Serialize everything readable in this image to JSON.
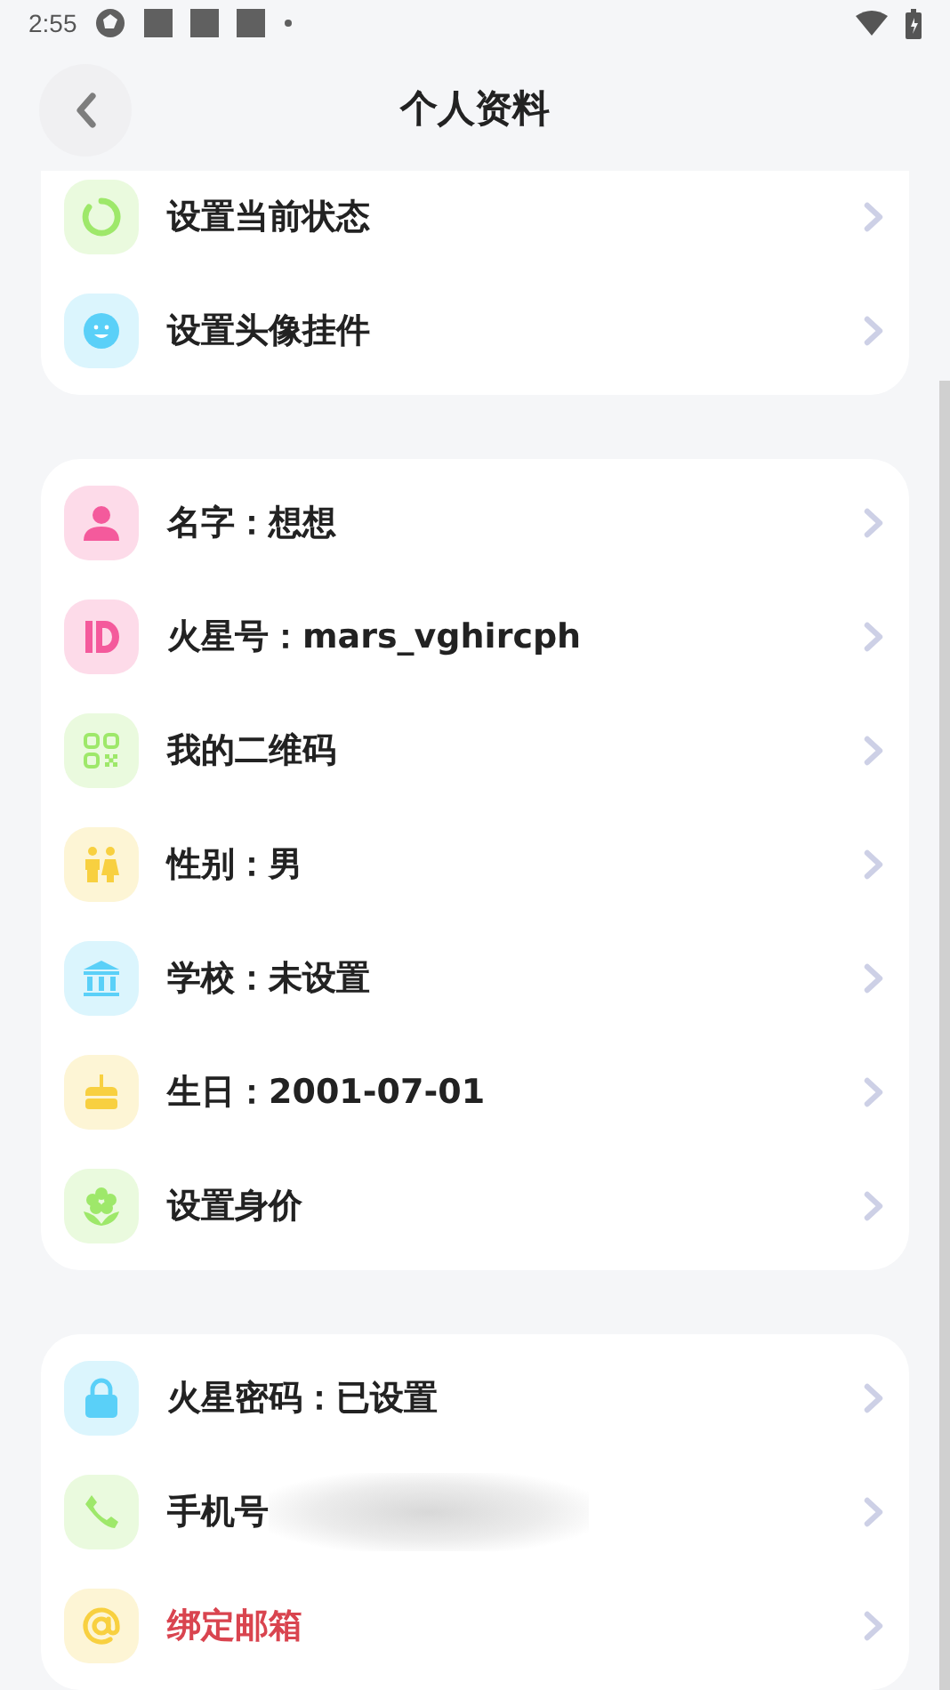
{
  "status_bar": {
    "time": "2:55"
  },
  "header": {
    "title": "个人资料"
  },
  "sections": [
    {
      "items": [
        {
          "label": "设置当前状态",
          "kind": "status",
          "color": "#9ee86a",
          "emphasis": false
        },
        {
          "label": "设置头像挂件",
          "kind": "face",
          "color": "#5ad0f8",
          "emphasis": false
        }
      ]
    },
    {
      "items": [
        {
          "label": "名字：想想",
          "kind": "person",
          "color": "#f45a9c",
          "emphasis": false
        },
        {
          "label": "火星号：mars_vghircph",
          "kind": "id",
          "color": "#f45a9c",
          "emphasis": false
        },
        {
          "label": "我的二维码",
          "kind": "qr",
          "color": "#9ee86a",
          "emphasis": false
        },
        {
          "label": "性别：男",
          "kind": "gender",
          "color": "#f8d040",
          "emphasis": false
        },
        {
          "label": "学校：未设置",
          "kind": "school",
          "color": "#5ad0f8",
          "emphasis": false
        },
        {
          "label": "生日：2001-07-01",
          "kind": "cake",
          "color": "#f8d040",
          "emphasis": false
        },
        {
          "label": "设置身价",
          "kind": "flower",
          "color": "#9ee86a",
          "emphasis": false
        }
      ]
    },
    {
      "items": [
        {
          "label": "火星密码：已设置",
          "kind": "lock",
          "color": "#5ad0f8",
          "emphasis": false
        },
        {
          "label": "手机号",
          "kind": "phone",
          "color": "#9ee86a",
          "emphasis": false,
          "redacted": true
        },
        {
          "label": "绑定邮箱",
          "kind": "at",
          "color": "#f8d040",
          "emphasis": true
        }
      ]
    }
  ]
}
